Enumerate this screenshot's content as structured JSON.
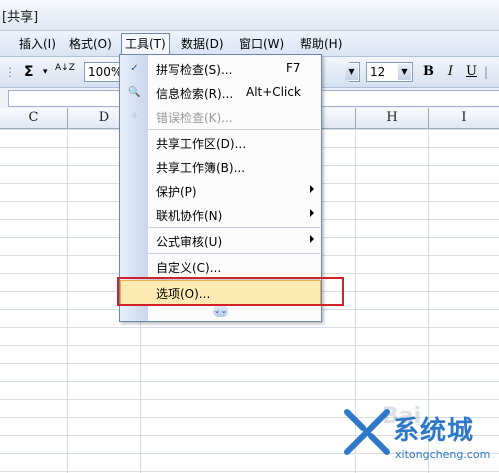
{
  "window": {
    "title_suffix": "[共享]"
  },
  "menubar": [
    {
      "label": "插入(I)"
    },
    {
      "label": "格式(O)"
    },
    {
      "label": "工具(T)"
    },
    {
      "label": "数据(D)"
    },
    {
      "label": "窗口(W)"
    },
    {
      "label": "帮助(H)"
    }
  ],
  "toolbar": {
    "sigma": "Σ",
    "sigma_arrow": "▾",
    "sort_ascending": "A↓Z",
    "zoom": "100%",
    "font_size": "12",
    "bold": "B",
    "italic": "I",
    "underline": "U"
  },
  "columns": [
    "C",
    "D",
    "H",
    "I"
  ],
  "tools_menu": {
    "items": [
      {
        "label": "拼写检查(S)...",
        "shortcut": "F7",
        "icon": "spell-check-icon"
      },
      {
        "label": "信息检索(R)...",
        "shortcut": "Alt+Click",
        "icon": "research-icon"
      },
      {
        "label": "错误检查(K)...",
        "shortcut": "",
        "icon": "error-check-icon",
        "disabled": true
      },
      {
        "label": "共享工作区(D)..."
      },
      {
        "label": "共享工作簿(B)..."
      },
      {
        "label": "保护(P)",
        "submenu": true
      },
      {
        "label": "联机协作(N)",
        "submenu": true
      },
      {
        "label": "公式审核(U)",
        "submenu": true
      },
      {
        "label": "自定义(C)..."
      },
      {
        "label": "选项(O)...",
        "highlighted": true
      }
    ],
    "expand_icon": "chevron-double-down-icon"
  },
  "watermark": {
    "brand": "系统城",
    "domain": "xitongcheng.com",
    "faint": "Bai"
  },
  "colors": {
    "menu_highlight": "#fde9b2",
    "annotation_red": "#d02327",
    "brand_blue": "#2d78c8"
  }
}
